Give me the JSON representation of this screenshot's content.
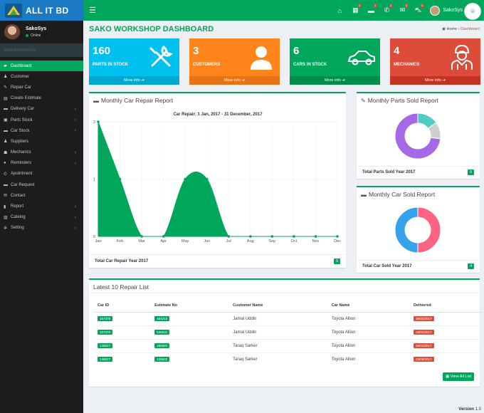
{
  "brand": {
    "name": "ALL IT BD"
  },
  "topbar": {
    "user_name": "SakoSys",
    "icons": [
      {
        "name": "home-icon",
        "glyph": "⌂",
        "badge": ""
      },
      {
        "name": "calendar-icon",
        "glyph": "▦",
        "badge": "4"
      },
      {
        "name": "car-icon",
        "glyph": "▬",
        "badge": "1"
      },
      {
        "name": "phone-icon",
        "glyph": "✆",
        "badge": "2"
      },
      {
        "name": "mail-icon",
        "glyph": "✉",
        "badge": "3"
      },
      {
        "name": "cart-icon",
        "glyph": "⛍",
        "badge": "4"
      }
    ]
  },
  "sidebar": {
    "user_name": "SakoSys",
    "status": "Online",
    "header": "MAIN NAVIGATION",
    "items": [
      {
        "label": "Dashboard",
        "icon": "dashboard-icon",
        "glyph": "▰",
        "active": true,
        "chevron": false
      },
      {
        "label": "Customer",
        "icon": "user-icon",
        "glyph": "♟",
        "active": false,
        "chevron": false
      },
      {
        "label": "Repair Car",
        "icon": "wrench-icon",
        "glyph": "✎",
        "active": false,
        "chevron": false
      },
      {
        "label": "Create Estimate",
        "icon": "table-icon",
        "glyph": "▤",
        "active": false,
        "chevron": false
      },
      {
        "label": "Delivery Car",
        "icon": "car-icon",
        "glyph": "▬",
        "active": false,
        "chevron": true
      },
      {
        "label": "Parts Stock",
        "icon": "cubes-icon",
        "glyph": "▣",
        "active": false,
        "chevron": true
      },
      {
        "label": "Car Stock",
        "icon": "car-stock-icon",
        "glyph": "▬",
        "active": false,
        "chevron": true
      },
      {
        "label": "Suppliers",
        "icon": "suppliers-icon",
        "glyph": "♟",
        "active": false,
        "chevron": false
      },
      {
        "label": "Mechanics",
        "icon": "users-icon",
        "glyph": "☗",
        "active": false,
        "chevron": true
      },
      {
        "label": "Reminders",
        "icon": "comments-icon",
        "glyph": "●",
        "active": false,
        "chevron": true
      },
      {
        "label": "Apointment",
        "icon": "phone-icon",
        "glyph": "✆",
        "active": false,
        "chevron": false
      },
      {
        "label": "Car Request",
        "icon": "car-request-icon",
        "glyph": "▬",
        "active": false,
        "chevron": false
      },
      {
        "label": "Contact",
        "icon": "envelope-icon",
        "glyph": "✉",
        "active": false,
        "chevron": false
      },
      {
        "label": "Report",
        "icon": "report-icon",
        "glyph": "▮",
        "active": false,
        "chevron": true
      },
      {
        "label": "Catelog",
        "icon": "catalog-icon",
        "glyph": "▧",
        "active": false,
        "chevron": true
      },
      {
        "label": "Setting",
        "icon": "gear-icon",
        "glyph": "✲",
        "active": false,
        "chevron": true
      }
    ]
  },
  "header": {
    "title": "SAKO WORKSHOP DASHBOARD",
    "breadcrumb_home": "Home",
    "breadcrumb_current": "Dashboard"
  },
  "stat_boxes": [
    {
      "number": "160",
      "label": "PARTS IN STOCK",
      "more": "More info ➔",
      "color": "#00c0ef",
      "footer_color": "#00a7d0",
      "icon": "tools-icon"
    },
    {
      "number": "3",
      "label": "CUSTOMERS",
      "more": "More info ➔",
      "color": "#ff851b",
      "footer_color": "#e67316",
      "icon": "customer-icon"
    },
    {
      "number": "6",
      "label": "CARS IN STOCK",
      "more": "More info ➔",
      "color": "#00a65a",
      "footer_color": "#008d4c",
      "icon": "car-icon"
    },
    {
      "number": "4",
      "label": "MECHANICS",
      "more": "More info ➔",
      "color": "#dd4b39",
      "footer_color": "#c23321",
      "icon": "mechanic-icon"
    }
  ],
  "repair_panel": {
    "title": "Monthly Car Repair Report",
    "footer_text": "Total Car Repair Year 2017",
    "footer_badge": "5"
  },
  "parts_panel": {
    "title": "Monthly Parts Sold Report",
    "footer_text": "Total Parts Sold Year 2017",
    "footer_badge": "5"
  },
  "cars_panel": {
    "title": "Monthly Car Sold Report",
    "footer_text": "Total Car Sold Year 2017",
    "footer_badge": "4"
  },
  "chart_data": [
    {
      "type": "area",
      "title": "Car Repair: 1 Jan, 2017 - 31 December, 2017",
      "categories": [
        "Jan",
        "Feb",
        "Mar",
        "Apr",
        "May",
        "Jun",
        "Jul",
        "Aug",
        "Sep",
        "Oct",
        "Nov",
        "Dec"
      ],
      "series": [
        {
          "values": [
            2,
            1,
            0,
            0,
            1,
            1,
            0,
            0,
            0,
            0,
            0,
            0
          ]
        }
      ],
      "ylim": [
        0,
        2
      ],
      "yticks": [
        0,
        1,
        2
      ],
      "color": "#00a65a",
      "grid": true
    },
    {
      "type": "pie",
      "donut": true,
      "slices": [
        {
          "value": 15,
          "color": "#4ecdc4"
        },
        {
          "value": 12,
          "color": "#cfcfd2"
        },
        {
          "value": 73,
          "color": "#a569e8"
        }
      ]
    },
    {
      "type": "pie",
      "donut": true,
      "slices": [
        {
          "value": 50,
          "color": "#ff6384"
        },
        {
          "value": 50,
          "color": "#36a2eb"
        }
      ]
    }
  ],
  "repair_list": {
    "title": "Latest 10 Repair List",
    "columns": [
      "Car ID",
      "Estimate No",
      "Customer Name",
      "Car Name",
      "Delivered"
    ],
    "rows": [
      [
        "157378",
        "464215",
        "Jamal Uddin",
        "Toyota Allion",
        "26/02/2017"
      ],
      [
        "157378",
        "536531",
        "Jamal Uddin",
        "Toyota Allion",
        "26/01/2017"
      ],
      [
        "148627",
        "465691",
        "Taraq Sarker",
        "Toyota Allion",
        "25/01/2017"
      ],
      [
        "148627",
        "128633",
        "Taraq Sarker",
        "Toyota Allion",
        "23/06/2017"
      ]
    ],
    "view_all": "▦ View All List"
  },
  "footer": {
    "version_label": "Version",
    "version": "1.0"
  }
}
